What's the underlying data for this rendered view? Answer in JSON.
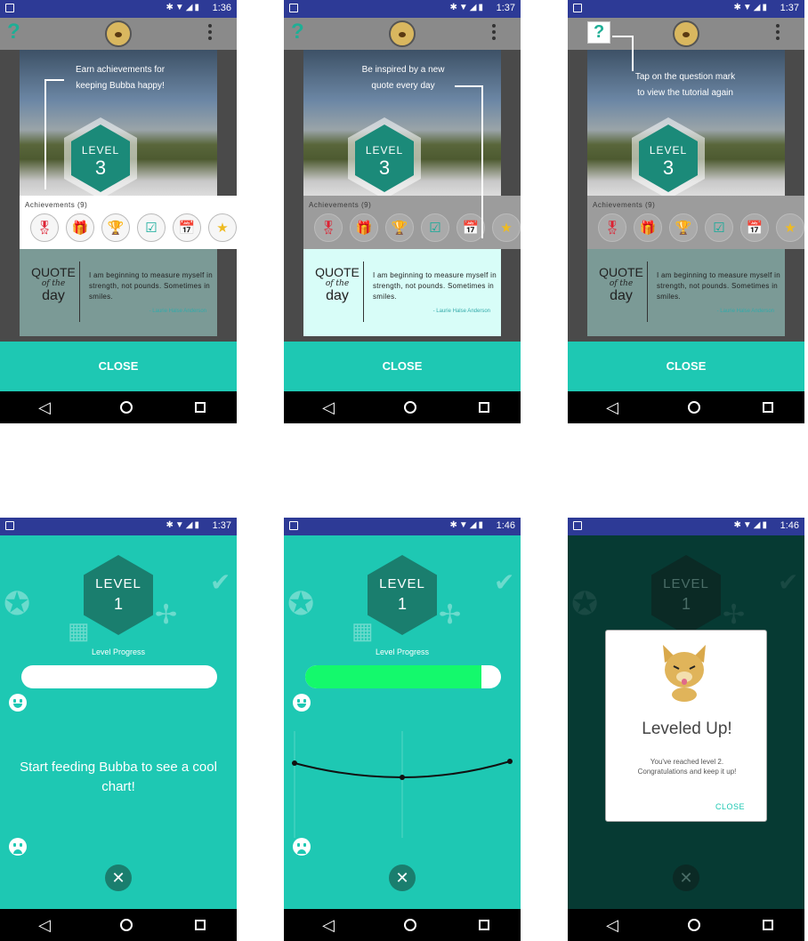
{
  "screens": {
    "s1": {
      "time": "1:36",
      "hint_lines": [
        "Earn achievements for",
        "keeping Bubba happy!"
      ],
      "close_label": "CLOSE"
    },
    "s2": {
      "time": "1:37",
      "hint_lines": [
        "Be inspired by a new",
        "quote every day"
      ],
      "close_label": "CLOSE"
    },
    "s3": {
      "time": "1:37",
      "hint_lines": [
        "Tap on the question mark",
        "to view the tutorial again"
      ],
      "close_label": "CLOSE"
    },
    "s4": {
      "time": "1:37",
      "level_word": "LEVEL",
      "level_number": "1",
      "progress_label": "Level Progress",
      "progress_fraction": 0,
      "message": "Start feeding Bubba to see a cool chart!"
    },
    "s5": {
      "time": "1:46",
      "level_word": "LEVEL",
      "level_number": "1",
      "progress_label": "Level Progress",
      "progress_fraction": 0.9
    },
    "s6": {
      "time": "1:46",
      "level_word": "LEVEL",
      "level_number": "1",
      "dialog_title": "Leveled Up!",
      "dialog_message_line1": "You've reached level 2.",
      "dialog_message_line2": "Congratulations and keep it up!",
      "dialog_close": "CLOSE"
    }
  },
  "tutorial": {
    "help_icon": "?",
    "level_word": "LEVEL",
    "level_number": "3",
    "achievements_title": "Achievements (9)",
    "achievement_icons": [
      "medal-icon",
      "gift-icon",
      "trophy-icon",
      "bookmark-check-icon",
      "calendar-plus-icon",
      "star-icon"
    ],
    "quote": {
      "label_top": "QUOTE",
      "label_mid": "of the",
      "label_bottom": "day",
      "text": "I am beginning to measure myself in strength, not pounds. Sometimes in smiles.",
      "author": "- Laurie Halse Anderson"
    }
  },
  "colors": {
    "teal": "#1ec8b3",
    "dark_teal": "#1a7e6e",
    "progress_green": "#14f96c",
    "status_bar": "#2d3a96"
  }
}
